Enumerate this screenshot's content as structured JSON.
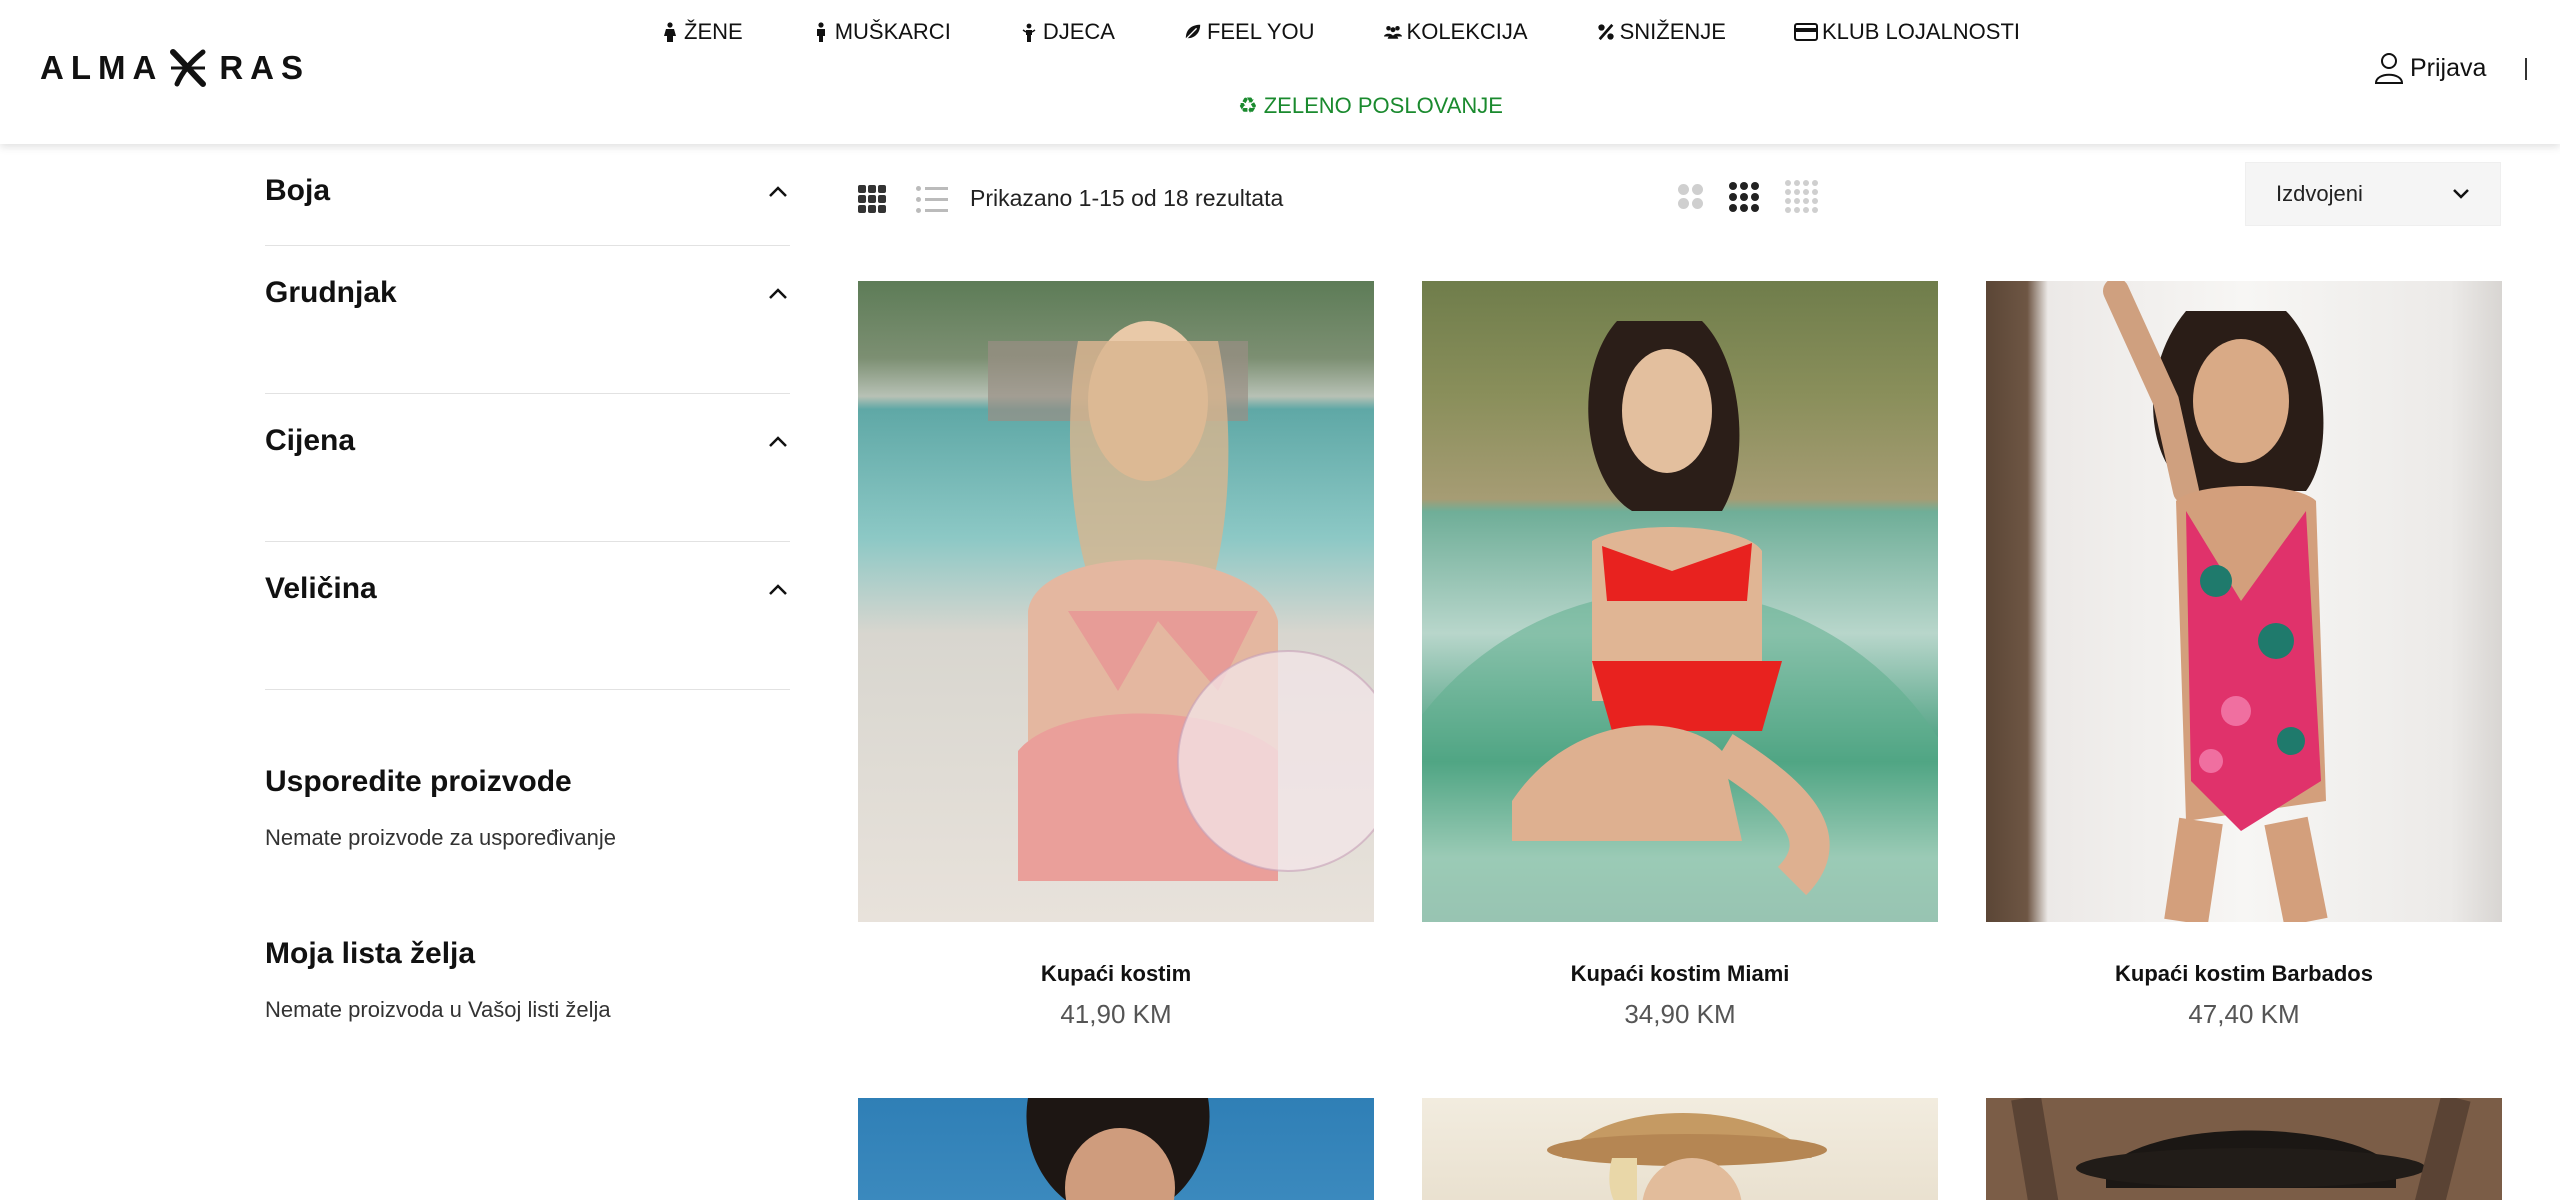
{
  "brand": {
    "left_word": "ALMA",
    "right_word": "RAS"
  },
  "nav": {
    "items": [
      {
        "label": "ŽENE",
        "icon": "woman-icon"
      },
      {
        "label": "MUŠKARCI",
        "icon": "man-icon"
      },
      {
        "label": "DJECA",
        "icon": "child-icon"
      },
      {
        "label": "FEEL YOU",
        "icon": "leaf-icon"
      },
      {
        "label": "KOLEKCIJA",
        "icon": "group-icon"
      },
      {
        "label": "SNIŽENJE",
        "icon": "percent-icon"
      },
      {
        "label": "KLUB LOJALNOSTI",
        "icon": "card-icon"
      }
    ],
    "green": {
      "label": "ZELENO POSLOVANJE",
      "icon": "recycle-icon",
      "color": "#1a8a2e"
    }
  },
  "header": {
    "login_label": "Prijava",
    "divider": "|"
  },
  "sidebar": {
    "filters": [
      {
        "label": "Boja"
      },
      {
        "label": "Grudnjak"
      },
      {
        "label": "Cijena"
      },
      {
        "label": "Veličina"
      }
    ],
    "compare": {
      "title": "Usporedite proizvode",
      "text": "Nemate proizvode za uspoređivanje"
    },
    "wishlist": {
      "title": "Moja lista želja",
      "text": "Nemate proizvoda u Vašoj listi želja"
    }
  },
  "toolbar": {
    "results": "Prikazano 1-15 od 18 rezultata",
    "sort_selected": "Izdvojeni"
  },
  "products": [
    {
      "name": "Kupaći kostim",
      "price": "41,90 KM"
    },
    {
      "name": "Kupaći kostim Miami",
      "price": "34,90 KM"
    },
    {
      "name": "Kupaći kostim Barbados",
      "price": "47,40 KM"
    }
  ]
}
